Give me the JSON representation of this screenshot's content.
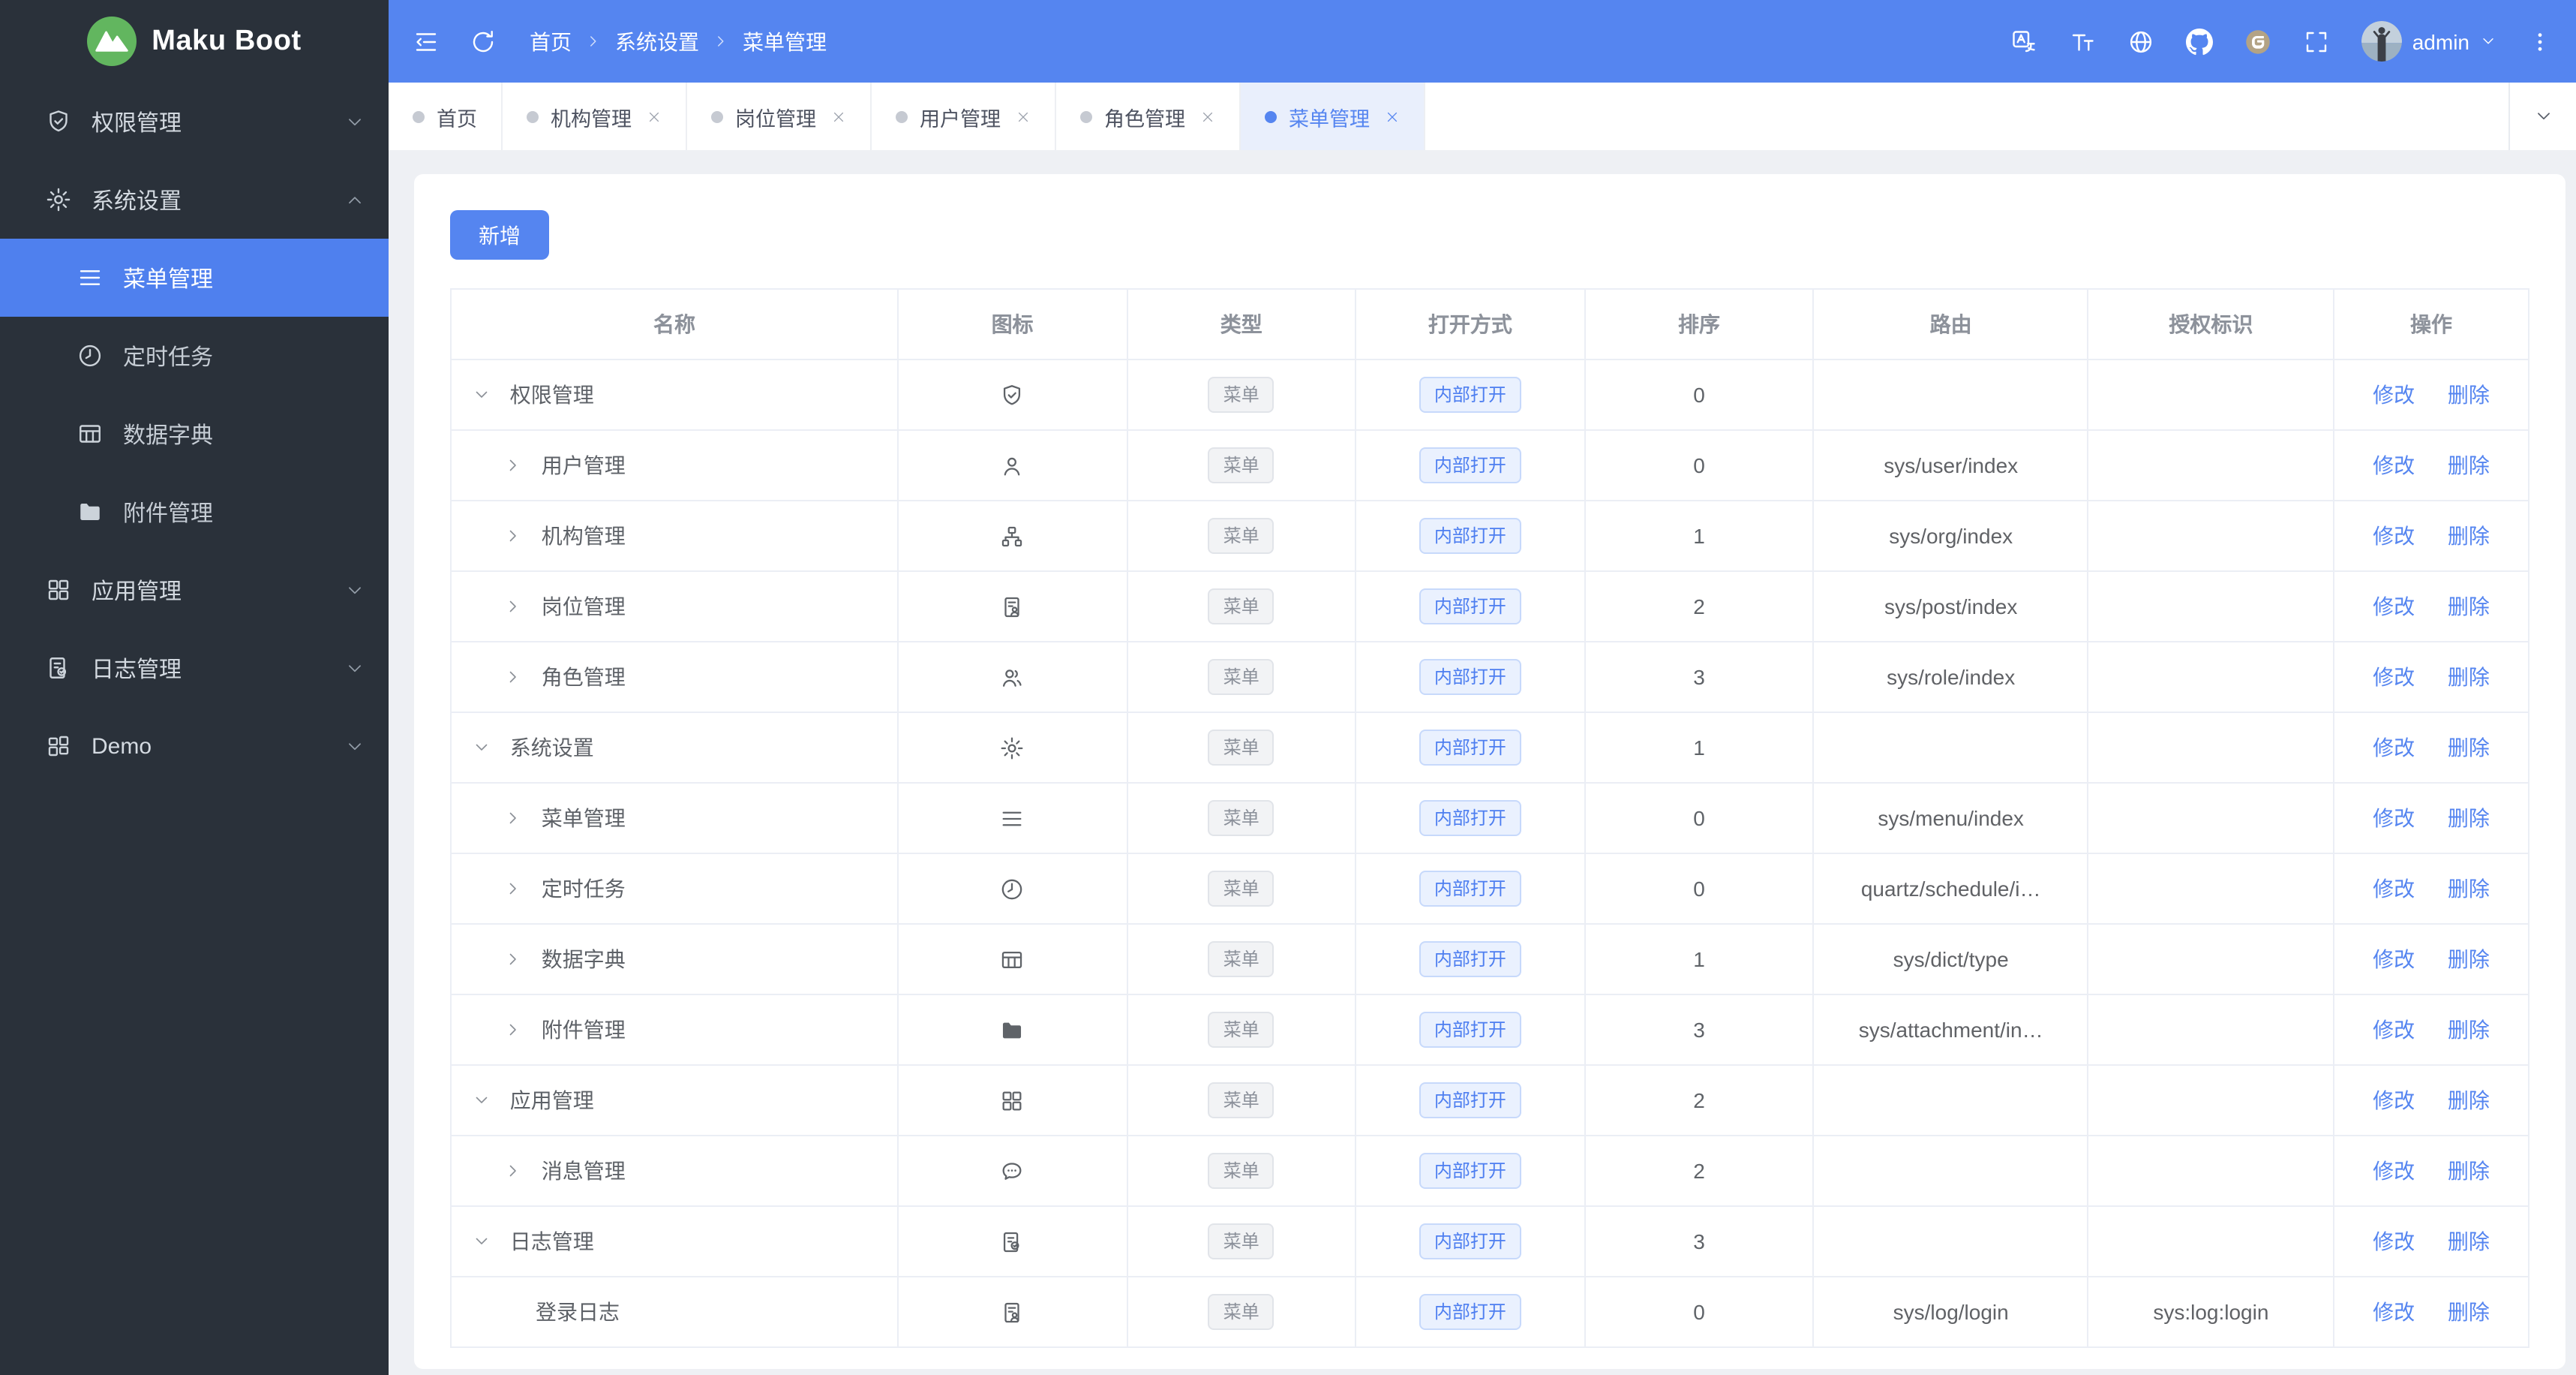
{
  "colors": {
    "primary": "#5585f0",
    "sidebar_bg": "#2a313a",
    "sidebar_active_bg": "#4f80ee",
    "page_bg": "#eef0f4",
    "logo_green": "#62b65f",
    "tab_active_bg": "#e9effc",
    "tag_open_text": "#4d7ef0",
    "table_border": "#ebeef5"
  },
  "app": {
    "title": "Maku Boot",
    "logo_icon": "logo-mountain"
  },
  "sidebar": {
    "menu": [
      {
        "label": "权限管理",
        "icon": "shield-check",
        "chevron": "chevron-down"
      },
      {
        "label": "系统设置",
        "icon": "gear",
        "chevron": "chevron-up"
      },
      {
        "label": "菜单管理",
        "icon": "menu",
        "sub": true,
        "active": true
      },
      {
        "label": "定时任务",
        "icon": "clock",
        "sub": true
      },
      {
        "label": "数据字典",
        "icon": "table",
        "sub": true
      },
      {
        "label": "附件管理",
        "icon": "folder",
        "sub": true
      },
      {
        "label": "应用管理",
        "icon": "grid",
        "chevron": "chevron-down"
      },
      {
        "label": "日志管理",
        "icon": "log-doc",
        "chevron": "chevron-down"
      },
      {
        "label": "Demo",
        "icon": "grid-alt",
        "chevron": "chevron-down"
      }
    ]
  },
  "header": {
    "left_icons": [
      {
        "icon": "menu-fold"
      },
      {
        "icon": "refresh"
      }
    ],
    "breadcrumb": [
      {
        "label": "首页",
        "sep": "chevron-right"
      },
      {
        "label": "系统设置",
        "sep": "chevron-right"
      },
      {
        "label": "菜单管理"
      }
    ],
    "right_icons": [
      {
        "icon": "translate"
      },
      {
        "icon": "font-size"
      },
      {
        "icon": "globe"
      },
      {
        "icon": "github"
      },
      {
        "icon": "gitee"
      },
      {
        "icon": "fullscreen"
      }
    ],
    "avatar_icon": "avatar",
    "user": "admin",
    "user_caret_icon": "chevron-down",
    "kebab_icon": "more-vertical"
  },
  "tabs": {
    "items": [
      {
        "label": "首页"
      },
      {
        "label": "机构管理",
        "close": "close"
      },
      {
        "label": "岗位管理",
        "close": "close"
      },
      {
        "label": "用户管理",
        "close": "close"
      },
      {
        "label": "角色管理",
        "close": "close"
      },
      {
        "label": "菜单管理",
        "close": "close",
        "active": true
      }
    ],
    "more_icon": "chevron-down"
  },
  "toolbar": {
    "add_label": "新增"
  },
  "table": {
    "columns": [
      "名称",
      "图标",
      "类型",
      "打开方式",
      "排序",
      "路由",
      "授权标识",
      "操作"
    ],
    "type_tag_label": "菜单",
    "open_tag_label": "内部打开",
    "edit_label": "修改",
    "delete_label": "删除",
    "rows": [
      {
        "name": "权限管理",
        "depth": 0,
        "toggle": "chevron-down",
        "icon": "shield-check",
        "sort": "0",
        "route": "",
        "auth": ""
      },
      {
        "name": "用户管理",
        "depth": 1,
        "toggle": "chevron-right",
        "icon": "user",
        "sort": "0",
        "route": "sys/user/index",
        "auth": ""
      },
      {
        "name": "机构管理",
        "depth": 1,
        "toggle": "chevron-right",
        "icon": "org",
        "sort": "1",
        "route": "sys/org/index",
        "auth": ""
      },
      {
        "name": "岗位管理",
        "depth": 1,
        "toggle": "chevron-right",
        "icon": "id-card",
        "sort": "2",
        "route": "sys/post/index",
        "auth": ""
      },
      {
        "name": "角色管理",
        "depth": 1,
        "toggle": "chevron-right",
        "icon": "users",
        "sort": "3",
        "route": "sys/role/index",
        "auth": ""
      },
      {
        "name": "系统设置",
        "depth": 0,
        "toggle": "chevron-down",
        "icon": "gear",
        "sort": "1",
        "route": "",
        "auth": ""
      },
      {
        "name": "菜单管理",
        "depth": 1,
        "toggle": "chevron-right",
        "icon": "menu",
        "sort": "0",
        "route": "sys/menu/index",
        "auth": ""
      },
      {
        "name": "定时任务",
        "depth": 1,
        "toggle": "chevron-right",
        "icon": "clock",
        "sort": "0",
        "route": "quartz/schedule/i…",
        "auth": ""
      },
      {
        "name": "数据字典",
        "depth": 1,
        "toggle": "chevron-right",
        "icon": "table",
        "sort": "1",
        "route": "sys/dict/type",
        "auth": ""
      },
      {
        "name": "附件管理",
        "depth": 1,
        "toggle": "chevron-right",
        "icon": "folder",
        "sort": "3",
        "route": "sys/attachment/in…",
        "auth": ""
      },
      {
        "name": "应用管理",
        "depth": 0,
        "toggle": "chevron-down",
        "icon": "grid",
        "sort": "2",
        "route": "",
        "auth": ""
      },
      {
        "name": "消息管理",
        "depth": 1,
        "toggle": "chevron-right",
        "icon": "chat",
        "sort": "2",
        "route": "",
        "auth": ""
      },
      {
        "name": "日志管理",
        "depth": 0,
        "toggle": "chevron-down",
        "icon": "log-doc",
        "sort": "3",
        "route": "",
        "auth": ""
      },
      {
        "name": "登录日志",
        "depth": 2,
        "toggle": "",
        "icon": "id-card",
        "sort": "0",
        "route": "sys/log/login",
        "auth": "sys:log:login"
      }
    ]
  }
}
